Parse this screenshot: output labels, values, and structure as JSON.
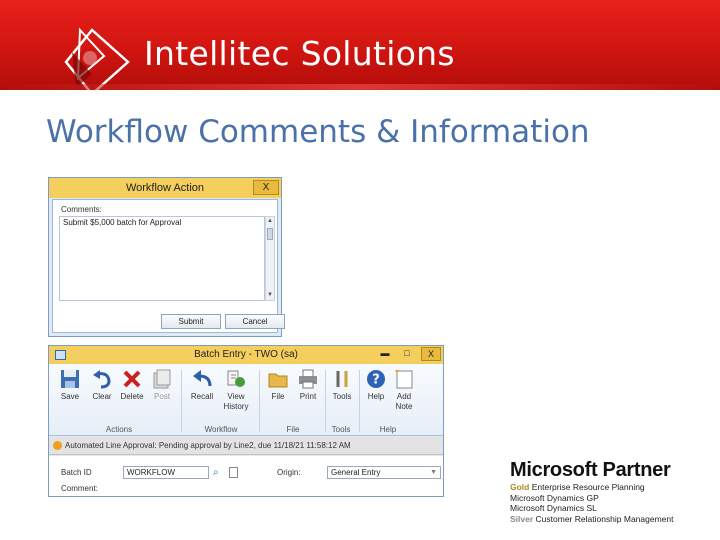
{
  "header": {
    "brand_name": "Intellitec Solutions",
    "page_title": "Workflow Comments & Information"
  },
  "workflow_dialog": {
    "title": "Workflow Action",
    "close_label": "X",
    "comments_label": "Comments:",
    "comments_value": "Submit $5,000 batch for Approval",
    "submit_label": "Submit",
    "cancel_label": "Cancel"
  },
  "batch_window": {
    "title": "Batch Entry  -  TWO (sa)",
    "controls": {
      "minimize": "▬",
      "maximize": "□",
      "close": "X"
    },
    "ribbon": {
      "buttons": [
        {
          "label": "Save"
        },
        {
          "label": "Clear"
        },
        {
          "label": "Delete"
        },
        {
          "label": "Post"
        },
        {
          "label": "Recall"
        },
        {
          "label": "View History"
        },
        {
          "label": "File"
        },
        {
          "label": "Print"
        },
        {
          "label": "Tools"
        },
        {
          "label": "Help"
        },
        {
          "label": "Add Note"
        }
      ],
      "groups": {
        "actions": "Actions",
        "workflow": "Workflow",
        "file": "File",
        "tools": "Tools",
        "help": "Help"
      }
    },
    "status_message": "Automated Line Approval: Pending approval by Line2, due 11/18/21 11:58:12 AM",
    "batch_id_label": "Batch ID",
    "batch_id_value": "WORKFLOW",
    "origin_label": "Origin:",
    "origin_value": "General Entry",
    "comment_label": "Comment:"
  },
  "partner": {
    "title": "Microsoft Partner",
    "gold_tier": "Gold",
    "gold_text": "Enterprise Resource Planning",
    "gp_line": "Microsoft Dynamics GP",
    "sl_line": "Microsoft Dynamics SL",
    "silver_tier": "Silver",
    "silver_text": "Customer Relationship Management"
  },
  "colors": {
    "banner_red": "#d01510",
    "title_blue": "#4a72a8",
    "dialog_title_bar": "#f4cf5e",
    "gold": "#b08a1e"
  }
}
